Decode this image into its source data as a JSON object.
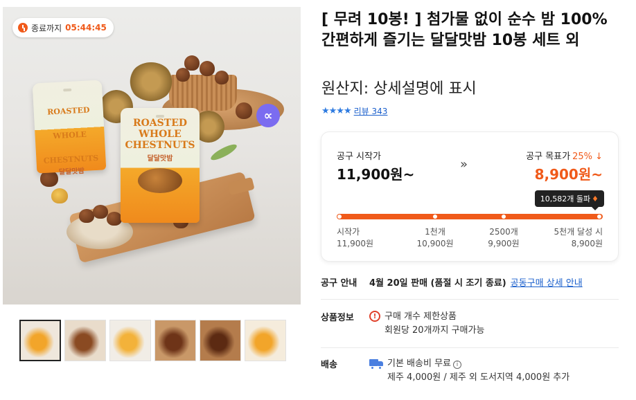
{
  "timer": {
    "label": "종료까지",
    "time": "05:44:45"
  },
  "image": {
    "pack_text_line1": "ROASTED",
    "pack_text_line2": "WHOLE",
    "pack_text_line3": "CHESTNUTS",
    "pack_text_kr": "달달맛밤",
    "badge_icon": "infinity-badge-icon"
  },
  "thumbnails": [
    {
      "name": "thumb-1",
      "bg": "#efe7dc",
      "accent": "#f2a52a"
    },
    {
      "name": "thumb-2",
      "bg": "#e9dccb",
      "accent": "#8a4a22"
    },
    {
      "name": "thumb-3",
      "bg": "#f1ede6",
      "accent": "#f3b23a"
    },
    {
      "name": "thumb-4",
      "bg": "#c99868",
      "accent": "#6e3418"
    },
    {
      "name": "thumb-5",
      "bg": "#b47c4c",
      "accent": "#5c2a12"
    },
    {
      "name": "thumb-6",
      "bg": "#f5ecdc",
      "accent": "#f2a52a"
    }
  ],
  "product": {
    "title": "[ 무려 10봉! ] 첨가물 없이 순수 밤 100% 간편하게 즐기는 달달맛밤 10봉 세트 외",
    "origin": "원산지: 상세설명에 표시",
    "stars": "★★★★",
    "review_link": "리뷰 343"
  },
  "group_buy": {
    "start_label": "공구 시작가",
    "start_price": "11,900원~",
    "arrow": "»",
    "goal_label": "공구 목표가",
    "goal_pct": "25% ↓",
    "goal_price": "8,900원~",
    "tooltip": "10,582개 돌파",
    "progress": 1.0,
    "ticks": [
      {
        "label": "시작가",
        "price": "11,900원"
      },
      {
        "label": "1천개",
        "price": "10,900원"
      },
      {
        "label": "2500개",
        "price": "9,900원"
      },
      {
        "label": "5천개 달성 시",
        "price": "8,900원"
      }
    ]
  },
  "info": {
    "notice_label": "공구 안내",
    "notice_text": "4월 20일 판매 (품절 시 조기 종료)",
    "notice_link": "공동구매 상세 안내",
    "product_label": "상품정보",
    "product_line1": "구매 개수 제한상품",
    "product_line2": "회원당 20개까지 구매가능",
    "shipping_label": "배송",
    "shipping_line1": "기본 배송비 무료",
    "shipping_line2": "제주 4,000원 / 제주 외 도서지역 4,000원 추가"
  },
  "colors": {
    "accent": "#f05a1a",
    "link": "#1a5fcc",
    "star": "#2e7be0"
  }
}
